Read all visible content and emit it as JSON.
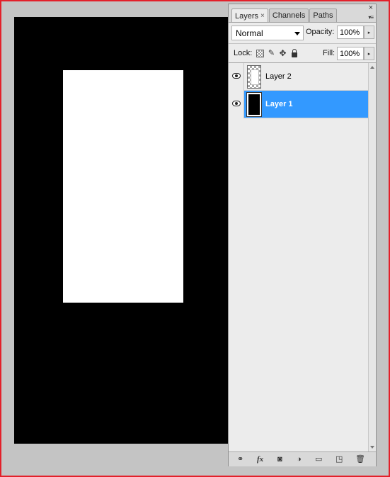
{
  "panel": {
    "tabs": [
      {
        "label": "Layers",
        "active": true,
        "close": "×"
      },
      {
        "label": "Channels",
        "active": false
      },
      {
        "label": "Paths",
        "active": false
      }
    ],
    "close_glyph": "×",
    "menu_glyph": "▾≡"
  },
  "blend_mode": {
    "value": "Normal"
  },
  "opacity": {
    "label": "Opacity:",
    "value": "100%"
  },
  "lock": {
    "label": "Lock:"
  },
  "fill": {
    "label": "Fill:",
    "value": "100%"
  },
  "layers": [
    {
      "name": "Layer 2",
      "visible": true,
      "selected": false,
      "thumbnail": "white-rect-on-transparent"
    },
    {
      "name": "Layer 1",
      "visible": true,
      "selected": true,
      "thumbnail": "black-fill"
    }
  ],
  "bottom_icons": {
    "link": "link-layers-icon",
    "fx": "fx",
    "mask": "add-mask-icon",
    "adjust": "adjustment-layer-icon",
    "group": "new-group-icon",
    "new": "new-layer-icon",
    "trash": "delete-layer-icon"
  },
  "colors": {
    "selection": "#3399ff",
    "frame": "#e3202a",
    "canvas": "#000000",
    "rect": "#ffffff"
  }
}
